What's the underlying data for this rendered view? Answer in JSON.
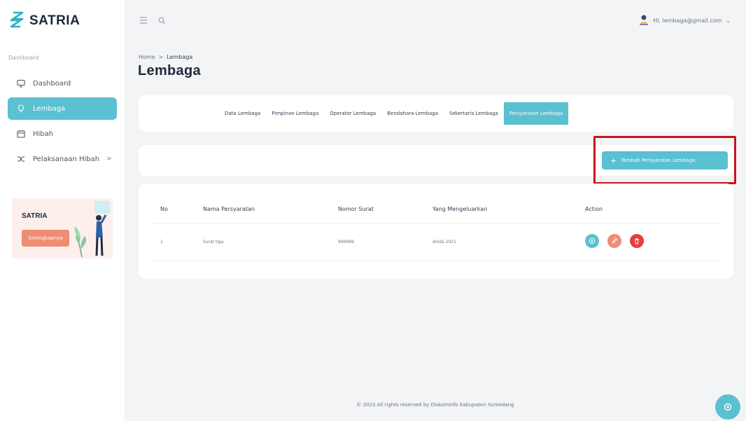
{
  "brand": {
    "name": "SATRIA"
  },
  "sidebar": {
    "section_label": "Dashboard",
    "items": [
      {
        "label": "Dashboard",
        "icon": "monitor-icon"
      },
      {
        "label": "Lembaga",
        "icon": "bulb-icon",
        "active": true
      },
      {
        "label": "Hibah",
        "icon": "calendar-icon"
      },
      {
        "label": "Pelaksanaan Hibah",
        "icon": "shuffle-icon",
        "chevron": ">"
      }
    ],
    "promo": {
      "title": "SATRIA",
      "button": "Selengkapnya"
    }
  },
  "topbar": {
    "user_email": "Hi, lembaga@gmail.com",
    "chevron": "⌄"
  },
  "breadcrumb": {
    "home": "Home",
    "separator": ">",
    "current": "Lembaga"
  },
  "page": {
    "title": "Lembaga"
  },
  "tabs": [
    "Data Lembaga",
    "Pimpinan Lembaga",
    "Operator Lembaga",
    "Bendahara Lembaga",
    "Sekertaris Lembaga",
    "Persyaratan Lembaga"
  ],
  "actions": {
    "add_label": "Tambah Persyaratan Lembaga",
    "add_icon": "+"
  },
  "table": {
    "headers": [
      "No",
      "Nama Persyaratan",
      "Nomor Surat",
      "Yang Mengeluarkan",
      "Action"
    ],
    "rows": [
      {
        "no": "1",
        "name": "Surat tiga",
        "nomor": "999999",
        "issuer": "dinda 2021"
      }
    ]
  },
  "footer": {
    "text": "© 2023 All rights reserved by Diskominfo Kabupaten Sumedang"
  },
  "colors": {
    "accent": "#5bc0cf",
    "warning": "#ee8c74",
    "danger": "#e53e3e",
    "highlight": "#c4161c"
  }
}
